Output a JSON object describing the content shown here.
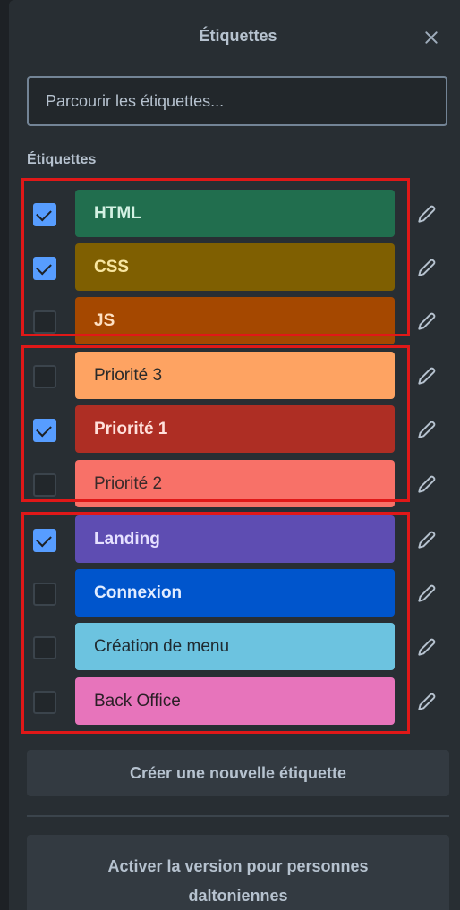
{
  "header": {
    "title": "Étiquettes"
  },
  "search": {
    "placeholder": "Parcourir les étiquettes..."
  },
  "section_label": "Étiquettes",
  "labels": [
    {
      "name": "HTML",
      "checked": true,
      "color": "#216e4e",
      "text_color": "#d3f1e3",
      "bold": true
    },
    {
      "name": "CSS",
      "checked": true,
      "color": "#7f5f01",
      "text_color": "#f8e6a0",
      "bold": true
    },
    {
      "name": "JS",
      "checked": false,
      "color": "#a54800",
      "text_color": "#ffe0c2",
      "bold": true
    },
    {
      "name": "Priorité 3",
      "checked": false,
      "color": "#fea362",
      "text_color": "#2a2a2a",
      "bold": false
    },
    {
      "name": "Priorité 1",
      "checked": true,
      "color": "#ae2e24",
      "text_color": "#ffe0db",
      "bold": true
    },
    {
      "name": "Priorité 2",
      "checked": false,
      "color": "#f87168",
      "text_color": "#3a2a2a",
      "bold": false
    },
    {
      "name": "Landing",
      "checked": true,
      "color": "#5e4db2",
      "text_color": "#e6e1ff",
      "bold": true
    },
    {
      "name": "Connexion",
      "checked": false,
      "color": "#0055cc",
      "text_color": "#e1ecff",
      "bold": true
    },
    {
      "name": "Création de menu",
      "checked": false,
      "color": "#6cc3e0",
      "text_color": "#1f2a30",
      "bold": false
    },
    {
      "name": "Back Office",
      "checked": false,
      "color": "#e774bb",
      "text_color": "#2a1f26",
      "bold": false
    }
  ],
  "actions": {
    "create_label": "Créer une nouvelle étiquette",
    "colorblind_label": "Activer la version pour personnes daltoniennes"
  },
  "highlight_color": "#e01818",
  "icons": [
    "close-icon",
    "check-icon",
    "pencil-icon"
  ]
}
